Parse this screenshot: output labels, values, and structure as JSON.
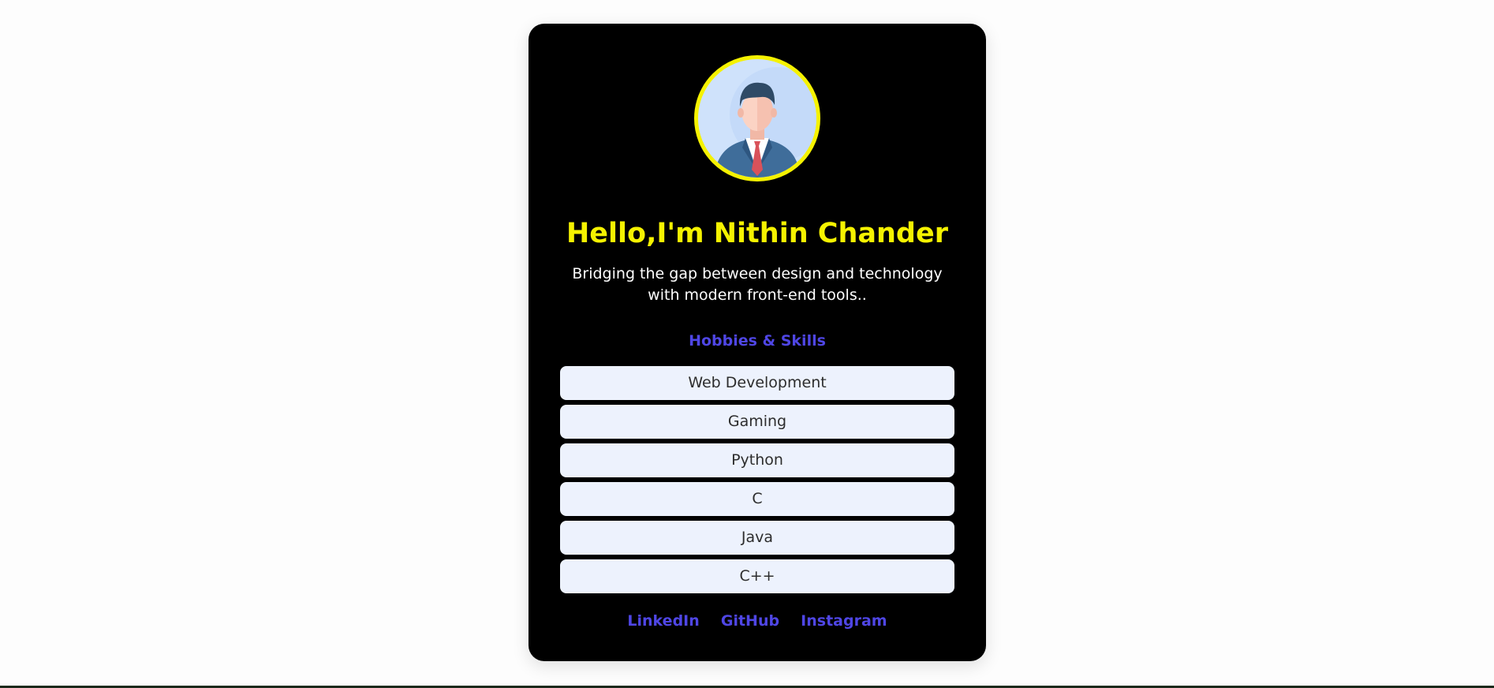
{
  "profile": {
    "name_heading": "Hello,I'm Nithin Chander",
    "tagline": "Bridging the gap between design and technology with modern front-end tools..",
    "avatar_icon": "businessman-avatar-icon"
  },
  "skills_section": {
    "title": "Hobbies & Skills",
    "items": [
      "Web Development",
      "Gaming",
      "Python",
      "C",
      "Java",
      "C++"
    ]
  },
  "social_links": [
    "LinkedIn",
    "GitHub",
    "Instagram"
  ],
  "colors": {
    "card_background": "#000000",
    "name_color": "#f5f200",
    "accent": "#4f46e5",
    "skill_background": "#edf2fd"
  }
}
